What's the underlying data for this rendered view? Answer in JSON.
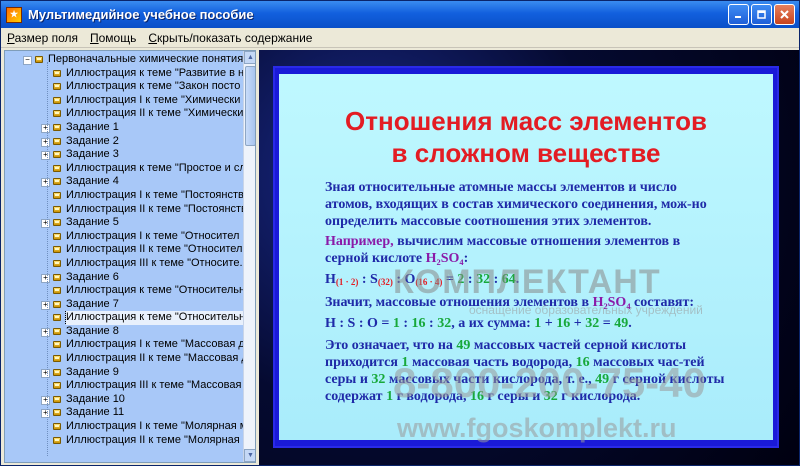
{
  "window": {
    "title": "Мультимедийное учебное пособие"
  },
  "menu": {
    "items": [
      {
        "label": "Размер поля",
        "underline": "Р"
      },
      {
        "label": "Помощь",
        "underline": "П"
      },
      {
        "label": "Скрыть/показать содержание",
        "underline": "С"
      }
    ]
  },
  "tree": {
    "items": [
      {
        "label": "Первоначальные химические понятия",
        "level": 0,
        "expander": "expanded"
      },
      {
        "label": "Иллюстрация к теме \"Развитие в н",
        "level": 1
      },
      {
        "label": "Иллюстрация к теме \"Закон посто",
        "level": 1
      },
      {
        "label": "Иллюстрация I к теме \"Химически",
        "level": 1
      },
      {
        "label": "Иллюстрация II к теме \"Химически",
        "level": 1
      },
      {
        "label": "Задание 1",
        "level": 1,
        "expander": "collapsed"
      },
      {
        "label": "Задание 2",
        "level": 1,
        "expander": "collapsed"
      },
      {
        "label": "Задание 3",
        "level": 1,
        "expander": "collapsed"
      },
      {
        "label": "Иллюстрация к теме \"Простое и сл",
        "level": 1
      },
      {
        "label": "Задание 4",
        "level": 1,
        "expander": "collapsed"
      },
      {
        "label": "Иллюстрация I к теме \"Постоянств",
        "level": 1
      },
      {
        "label": "Иллюстрация II к теме \"Постоянств",
        "level": 1
      },
      {
        "label": "Задание 5",
        "level": 1,
        "expander": "collapsed"
      },
      {
        "label": "Иллюстрация I к теме \"Относител",
        "level": 1
      },
      {
        "label": "Иллюстрация II к теме \"Относител",
        "level": 1
      },
      {
        "label": "Иллюстрация III к теме \"Относите.",
        "level": 1
      },
      {
        "label": "Задание 6",
        "level": 1,
        "expander": "collapsed"
      },
      {
        "label": "Иллюстрация к теме \"Относительн",
        "level": 1
      },
      {
        "label": "Задание 7",
        "level": 1,
        "expander": "collapsed"
      },
      {
        "label": "Иллюстрация к теме \"Относительн",
        "level": 1,
        "selected": true
      },
      {
        "label": "Задание 8",
        "level": 1,
        "expander": "collapsed"
      },
      {
        "label": "Иллюстрация I к теме \"Массовая д",
        "level": 1
      },
      {
        "label": "Иллюстрация II к теме \"Массовая д",
        "level": 1
      },
      {
        "label": "Задание 9",
        "level": 1,
        "expander": "collapsed"
      },
      {
        "label": "Иллюстрация III к теме \"Массовая",
        "level": 1
      },
      {
        "label": "Задание 10",
        "level": 1,
        "expander": "collapsed"
      },
      {
        "label": "Задание 11",
        "level": 1,
        "expander": "collapsed"
      },
      {
        "label": "Иллюстрация I к теме \"Молярная м",
        "level": 1
      },
      {
        "label": "Иллюстрация II к теме \"Молярная м",
        "level": 1
      }
    ]
  },
  "slide": {
    "title_line1": "Отношения масс элементов",
    "title_line2": "в сложном веществе",
    "para1": "Зная относительные атомные массы элементов и число атомов, входящих в состав химического соединения, мож-но определить массовые соотношения этих элементов.",
    "para2_lead": "Например,",
    "para2_rest": " вычислим массовые отношения элементов в серной кислоте ",
    "formula": "H₂SO₄",
    "para2_end": ":",
    "calc": {
      "h": "H",
      "h_sub": "(1 · 2)",
      "sep1": " : S",
      "s_sub": "(32)",
      "sep2": " : O",
      "o_sub": "(16 · 4)",
      "eq": " = ",
      "v1": "2",
      "c1": " : ",
      "v2": "32",
      "c2": " : ",
      "v3": "64",
      "end": "."
    },
    "para3_a": "Значит, массовые отношения элементов в ",
    "para3_formula": "H₂SO₄",
    "para3_b": " составят:",
    "ratio": {
      "lhs": "H : S : O = ",
      "v1": "1",
      "c1": " : ",
      "v2": "16",
      "c2": " : ",
      "v3": "32",
      "mid": ", а их сумма: ",
      "s1": "1",
      "p1": " + ",
      "s2": "16",
      "p2": " + ",
      "s3": "32",
      "eq": " = ",
      "sum": "49",
      "end": "."
    },
    "para4": {
      "a": "Это означает, что на ",
      "n1": "49",
      "b": " массовых частей серной кислоты приходится ",
      "n2": "1",
      "c": " массовая часть водорода, ",
      "n3": "16",
      "d": " массовых час-тей серы и ",
      "n4": "32",
      "e": " массовых части кислорода, т. е., ",
      "n5": "49",
      "f": " г серной кислоты содержат ",
      "n6": "1",
      "g": " г водорода, ",
      "n7": "16",
      "h": " г серы и ",
      "n8": "32",
      "i": " г кислорода."
    }
  },
  "watermark": {
    "logo": "КОМПЛЕКТАНТ",
    "subtitle": "оснащение образовательных учреждений",
    "phone": "8-800-200-75-40",
    "url": "www.fgoskomplekt.ru"
  }
}
